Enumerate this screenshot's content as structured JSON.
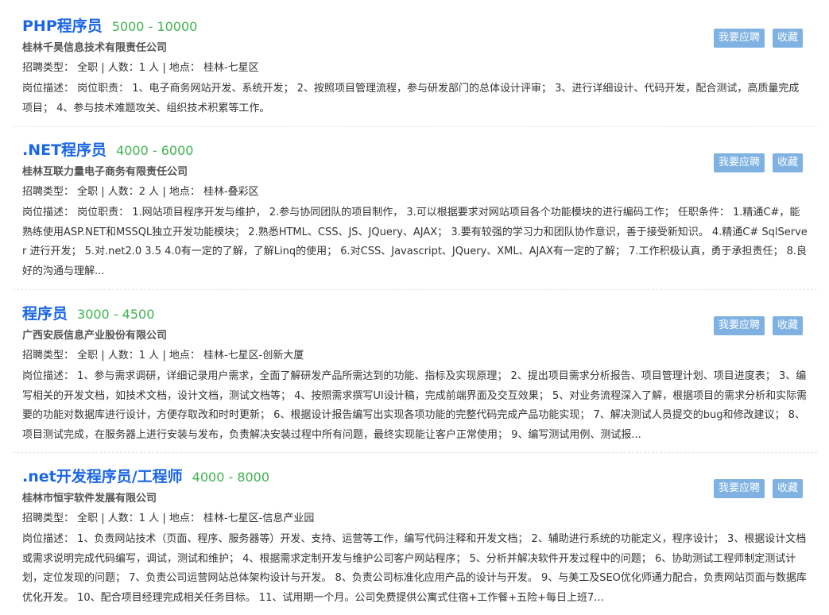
{
  "buttons": {
    "apply": "我要应聘",
    "favorite": "收藏"
  },
  "labels": {
    "type": "招聘类型：",
    "count": "人数：",
    "place": "地点：",
    "desc": "岗位描述："
  },
  "jobs": [
    {
      "title": "PHP程序员",
      "salary": "5000 - 10000",
      "company": "桂林千昊信息技术有限责任公司",
      "meta": "招聘类型：  全职 | 人数：1 人 | 地点：  桂林-七星区",
      "desc": "岗位描述：  岗位职责： 1、电子商务网站开发、系统开发； 2、按照项目管理流程，参与研发部门的总体设计评审； 3、进行详细设计、代码开发，配合测试，高质量完成项目； 4、参与技术难题攻关、组织技术积累等工作。"
    },
    {
      "title": ".NET程序员",
      "salary": "4000 - 6000",
      "company": "桂林互联力量电子商务有限责任公司",
      "meta": "招聘类型：  全职 | 人数：2 人 | 地点：  桂林-叠彩区",
      "desc": "岗位描述：  岗位职责： 1.网站项目程序开发与维护， 2.参与协同团队的项目制作， 3.可以根据要求对网站项目各个功能模块的进行编码工作； 任职条件： 1.精通C#，能熟练使用ASP.NET和MSSQL独立开发功能模块； 2.熟悉HTML、CSS、JS、JQuery、AJAX； 3.要有较强的学习力和团队协作意识，善于接受新知识。 4.精通C# SqlServer 进行开发； 5.对.net2.0 3.5 4.0有一定的了解，了解Linq的使用； 6.对CSS、Javascript、JQuery、XML、AJAX有一定的了解； 7.工作积极认真，勇于承担责任； 8.良好的沟通与理解..."
    },
    {
      "title": "程序员",
      "salary": "3000 - 4500",
      "company": "广西安辰信息产业股份有限公司",
      "meta": "招聘类型：  全职 | 人数：1 人 | 地点：  桂林-七星区-创新大厦",
      "desc": "岗位描述：  1、参与需求调研，详细记录用户需求，全面了解研发产品所需达到的功能、指标及实现原理； 2、提出项目需求分析报告、项目管理计划、项目进度表； 3、编写相关的开发文档，如技术文档，设计文档，测试文档等； 4、按照需求撰写UI设计稿，完成前端界面及交互效果； 5、对业务流程深入了解，根据项目的需求分析和实际需要的功能对数据库进行设计，方便存取改和时时更新； 6、根据设计报告编写出实现各项功能的完整代码完成产品功能实现； 7、解决测试人员提交的bug和修改建议； 8、项目测试完成，在服务器上进行安装与发布，负责解决安装过程中所有问题，最终实现能让客户正常使用； 9、编写测试用例、测试报..."
    },
    {
      "title": ".net开发程序员/工程师",
      "salary": "4000 - 8000",
      "company": "桂林市恒宇软件发展有限公司",
      "meta": "招聘类型：  全职 | 人数：1 人 | 地点：  桂林-七星区-信息产业园",
      "desc": "岗位描述：  1、负责网站技术（页面、程序、服务器等）开发、支持、运营等工作，编写代码注释和开发文档； 2、辅助进行系统的功能定义，程序设计； 3、根据设计文档或需求说明完成代码编写，调试，测试和维护； 4、根据需求定制开发与维护公司客户网站程序； 5、分析并解决软件开发过程中的问题； 6、协助测试工程师制定测试计划，定位发现的问题； 7、负责公司运营网站总体架构设计与开发。 8、负责公司标准化应用产品的设计与开发。 9、与美工及SEO优化师通力配合，负责网站页面与数据库优化开发。 10、配合项目经理完成相关任务目标。 11、试用期一个月。公司免费提供公寓式住宿+工作餐+五险+每日上班7..."
    }
  ]
}
